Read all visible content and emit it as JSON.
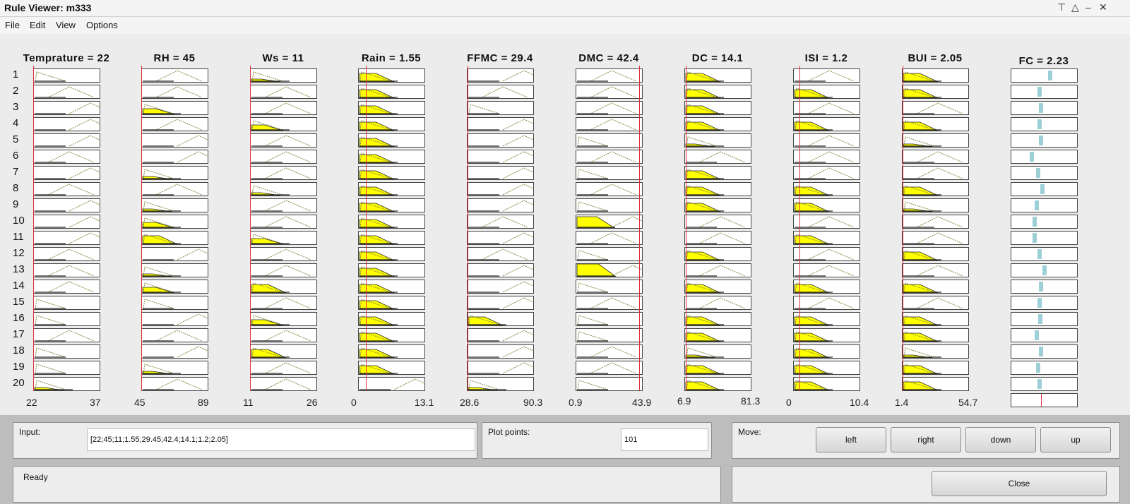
{
  "window": {
    "title": "Rule Viewer: m333",
    "controls": [
      "pin-icon",
      "maximize-icon",
      "minimize-icon",
      "close-icon"
    ]
  },
  "menu": [
    "File",
    "Edit",
    "View",
    "Options"
  ],
  "inputs": [
    {
      "title": "Temprature = 22",
      "min": "22",
      "max": "37",
      "value_frac": 0.0,
      "rows": [
        [
          0,
          0
        ],
        [
          1,
          0
        ],
        [
          2,
          0
        ],
        [
          2,
          0
        ],
        [
          2,
          0
        ],
        [
          1,
          0
        ],
        [
          2,
          0
        ],
        [
          1,
          0
        ],
        [
          2,
          0
        ],
        [
          2,
          0
        ],
        [
          2,
          0
        ],
        [
          1,
          0
        ],
        [
          1,
          0
        ],
        [
          1,
          0
        ],
        [
          0,
          0
        ],
        [
          0,
          0
        ],
        [
          1,
          0
        ],
        [
          0,
          0
        ],
        [
          0,
          0
        ],
        [
          0,
          1
        ]
      ]
    },
    {
      "title": "RH = 45",
      "min": "45",
      "max": "89",
      "value_frac": 0.0,
      "rows": [
        [
          1,
          0
        ],
        [
          1,
          0
        ],
        [
          0,
          2
        ],
        [
          1,
          0
        ],
        [
          2,
          0
        ],
        [
          2,
          0
        ],
        [
          0,
          1
        ],
        [
          1,
          0
        ],
        [
          0,
          1
        ],
        [
          0,
          2
        ],
        [
          0,
          3
        ],
        [
          2,
          0
        ],
        [
          0,
          1
        ],
        [
          0,
          2
        ],
        [
          0,
          0
        ],
        [
          2,
          0
        ],
        [
          1,
          0
        ],
        [
          2,
          0
        ],
        [
          0,
          1
        ],
        [
          1,
          0
        ]
      ]
    },
    {
      "title": "Ws = 11",
      "min": "11",
      "max": "26",
      "value_frac": 0.0,
      "rows": [
        [
          0,
          1
        ],
        [
          1,
          0
        ],
        [
          1,
          0
        ],
        [
          0,
          2
        ],
        [
          1,
          0
        ],
        [
          1,
          0
        ],
        [
          1,
          0
        ],
        [
          0,
          1
        ],
        [
          1,
          0
        ],
        [
          1,
          0
        ],
        [
          0,
          2
        ],
        [
          1,
          0
        ],
        [
          1,
          0
        ],
        [
          0,
          3
        ],
        [
          1,
          0
        ],
        [
          0,
          2
        ],
        [
          1,
          0
        ],
        [
          0,
          3
        ],
        [
          1,
          0
        ],
        [
          1,
          0
        ]
      ]
    },
    {
      "title": "Rain = 1.55",
      "min": "0",
      "max": "13.1",
      "value_frac": 0.12,
      "rows": [
        [
          0,
          3
        ],
        [
          0,
          3
        ],
        [
          0,
          3
        ],
        [
          0,
          3
        ],
        [
          0,
          3
        ],
        [
          0,
          3
        ],
        [
          0,
          3
        ],
        [
          0,
          3
        ],
        [
          0,
          3
        ],
        [
          0,
          3
        ],
        [
          0,
          3
        ],
        [
          0,
          3
        ],
        [
          0,
          3
        ],
        [
          0,
          3
        ],
        [
          0,
          3
        ],
        [
          0,
          3
        ],
        [
          0,
          3
        ],
        [
          0,
          3
        ],
        [
          0,
          3
        ],
        [
          2,
          0
        ]
      ]
    },
    {
      "title": "FFMC = 29.4",
      "min": "28.6",
      "max": "90.3",
      "value_frac": 0.01,
      "rows": [
        [
          2,
          0
        ],
        [
          1,
          0
        ],
        [
          0,
          0
        ],
        [
          2,
          0
        ],
        [
          2,
          0
        ],
        [
          2,
          0
        ],
        [
          2,
          0
        ],
        [
          2,
          0
        ],
        [
          2,
          0
        ],
        [
          1,
          0
        ],
        [
          2,
          0
        ],
        [
          1,
          0
        ],
        [
          2,
          0
        ],
        [
          2,
          0
        ],
        [
          2,
          0
        ],
        [
          0,
          3
        ],
        [
          2,
          0
        ],
        [
          2,
          0
        ],
        [
          2,
          0
        ],
        [
          0,
          1
        ]
      ]
    },
    {
      "title": "DMC = 42.4",
      "min": "0.9",
      "max": "43.9",
      "value_frac": 0.97,
      "rows": [
        [
          1,
          0
        ],
        [
          1,
          0
        ],
        [
          1,
          0
        ],
        [
          1,
          0
        ],
        [
          0,
          0
        ],
        [
          1,
          0
        ],
        [
          0,
          0
        ],
        [
          1,
          0
        ],
        [
          0,
          0
        ],
        [
          2,
          4
        ],
        [
          1,
          0
        ],
        [
          0,
          0
        ],
        [
          2,
          5
        ],
        [
          0,
          0
        ],
        [
          1,
          0
        ],
        [
          0,
          0
        ],
        [
          0,
          0
        ],
        [
          1,
          0
        ],
        [
          1,
          0
        ],
        [
          0,
          0
        ]
      ]
    },
    {
      "title": "DC = 14.1",
      "min": "6.9",
      "max": "81.3",
      "value_frac": 0.02,
      "rows": [
        [
          0,
          3
        ],
        [
          0,
          3
        ],
        [
          0,
          3
        ],
        [
          0,
          3
        ],
        [
          0,
          1
        ],
        [
          1,
          0
        ],
        [
          0,
          3
        ],
        [
          0,
          3
        ],
        [
          0,
          3
        ],
        [
          1,
          0
        ],
        [
          1,
          0
        ],
        [
          0,
          3
        ],
        [
          1,
          0
        ],
        [
          0,
          3
        ],
        [
          1,
          0
        ],
        [
          0,
          3
        ],
        [
          0,
          3
        ],
        [
          0,
          1
        ],
        [
          0,
          3
        ],
        [
          0,
          3
        ]
      ]
    },
    {
      "title": "ISI = 1.2",
      "min": "0",
      "max": "10.4",
      "value_frac": 0.1,
      "rows": [
        [
          1,
          0
        ],
        [
          0,
          3
        ],
        [
          1,
          0
        ],
        [
          0,
          3
        ],
        [
          1,
          0
        ],
        [
          1,
          0
        ],
        [
          1,
          0
        ],
        [
          0,
          3
        ],
        [
          0,
          3
        ],
        [
          1,
          0
        ],
        [
          0,
          3
        ],
        [
          1,
          0
        ],
        [
          1,
          0
        ],
        [
          0,
          3
        ],
        [
          1,
          0
        ],
        [
          0,
          3
        ],
        [
          0,
          3
        ],
        [
          0,
          3
        ],
        [
          0,
          3
        ],
        [
          0,
          3
        ]
      ]
    },
    {
      "title": "BUI = 2.05",
      "min": "1.4",
      "max": "54.7",
      "value_frac": 0.01,
      "rows": [
        [
          0,
          3
        ],
        [
          0,
          3
        ],
        [
          1,
          0
        ],
        [
          0,
          3
        ],
        [
          0,
          1
        ],
        [
          1,
          0
        ],
        [
          1,
          0
        ],
        [
          0,
          3
        ],
        [
          0,
          1
        ],
        [
          1,
          0
        ],
        [
          1,
          0
        ],
        [
          0,
          3
        ],
        [
          1,
          0
        ],
        [
          0,
          3
        ],
        [
          1,
          0
        ],
        [
          0,
          3
        ],
        [
          0,
          3
        ],
        [
          0,
          1
        ],
        [
          0,
          3
        ],
        [
          0,
          3
        ]
      ]
    }
  ],
  "output": {
    "title": "FC = 2.23",
    "value_frac": 0.45,
    "bar_positions": [
      0.6,
      0.42,
      0.45,
      0.42,
      0.45,
      0.3,
      0.4,
      0.47,
      0.38,
      0.35,
      0.35,
      0.42,
      0.5,
      0.45,
      0.42,
      0.44,
      0.38,
      0.45,
      0.4,
      0.42
    ]
  },
  "row_labels": [
    "1",
    "2",
    "3",
    "4",
    "5",
    "6",
    "7",
    "8",
    "9",
    "10",
    "11",
    "12",
    "13",
    "14",
    "15",
    "16",
    "17",
    "18",
    "19",
    "20"
  ],
  "bottom": {
    "input_label": "Input:",
    "input_value": "[22;45;11;1.55;29.45;42.4;14.1;1.2;2.05]",
    "plot_points_label": "Plot points:",
    "plot_points_value": "101",
    "move_label": "Move:",
    "buttons": {
      "left": "left",
      "right": "right",
      "down": "down",
      "up": "up",
      "close": "Close"
    },
    "status": "Ready"
  },
  "colors": {
    "fill": "#ffff00",
    "curve": "#8c8c4a",
    "red_line": "#e0303a",
    "output_bar": "#9ccfd6"
  }
}
